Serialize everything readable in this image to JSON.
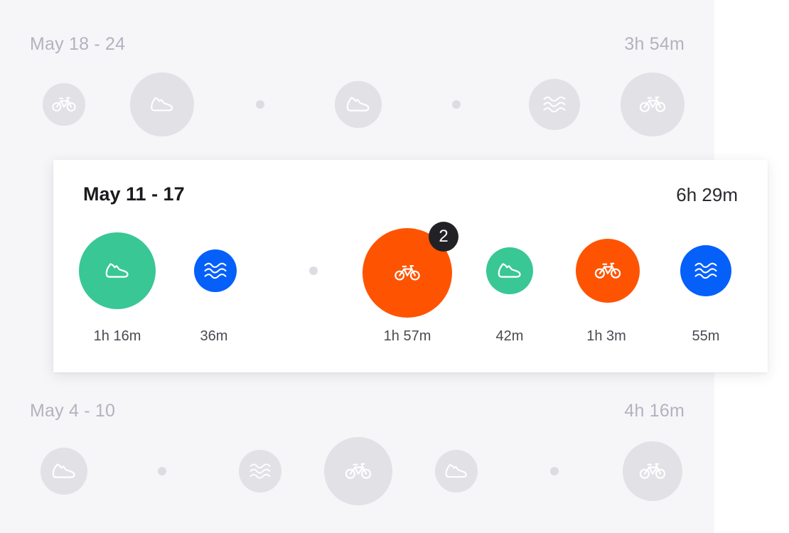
{
  "weeks": {
    "may18": {
      "title": "May 18 - 24",
      "total": "3h 54m"
    },
    "may11": {
      "title": "May 11 - 17",
      "total": "6h 29m",
      "durations": [
        "1h 16m",
        "36m",
        "1h 57m",
        "42m",
        "1h 3m",
        "55m"
      ],
      "badge_count": "2"
    },
    "may4": {
      "title": "May 4 - 10",
      "total": "4h 16m"
    }
  },
  "colors": {
    "run": "#38c795",
    "swim": "#0560fa",
    "bike": "#fe5402",
    "muted": "#e1e1e6",
    "background": "#f6f6f8"
  },
  "icons": {
    "run": "shoe-icon",
    "swim": "waves-icon",
    "bike": "bicycle-icon"
  }
}
